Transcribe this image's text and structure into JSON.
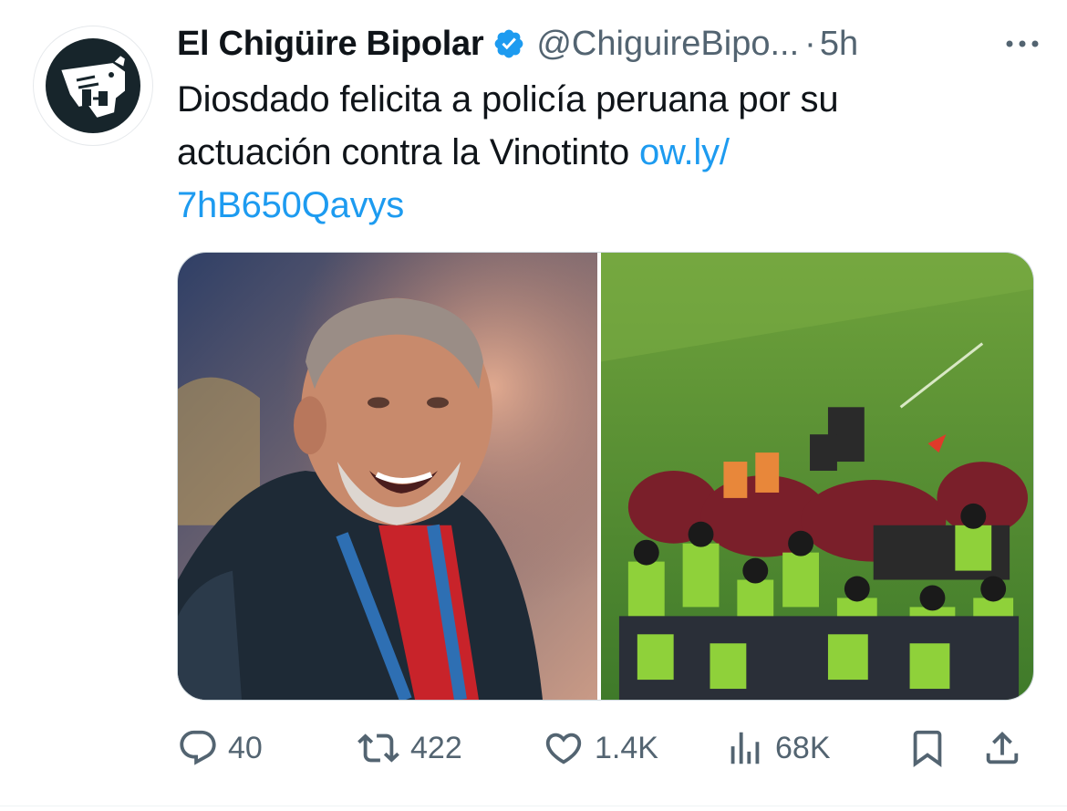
{
  "tweet": {
    "author": {
      "display_name": "El Chigüire Bipolar",
      "handle": "@ChiguireBipo...",
      "verified": true,
      "avatar_icon": "capybara-logo-icon"
    },
    "separator": "·",
    "time": "5h",
    "text": "Diosdado felicita a policía peruana por su actuación contra la Vinotinto ",
    "link_text": "ow.ly/\n7hB650Qavys",
    "media": {
      "left_image": "smiling-politician-photo",
      "right_image": "football-team-police-photo"
    },
    "actions": {
      "reply_count": "40",
      "retweet_count": "422",
      "like_count": "1.4K",
      "view_count": "68K"
    }
  },
  "colors": {
    "text": "#0f1419",
    "secondary": "#536471",
    "link": "#1d9bf0",
    "verified": "#1d9bf0",
    "border": "#cfd9de"
  }
}
